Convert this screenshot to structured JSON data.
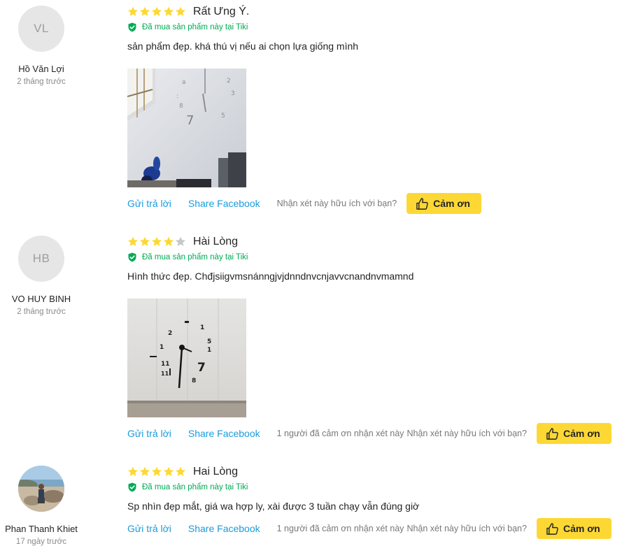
{
  "reviews": [
    {
      "avatar_initials": "VL",
      "user_name": "Hồ Văn Lợi",
      "date": "2 tháng trước",
      "rating": 5,
      "title": "Rất Ưng Ý.",
      "bought_label": "Đã mua sản phẩm này tại Tiki",
      "comment": "sản phẩm đẹp. khá thú vị nếu ai chọn lựa giống mình",
      "has_photo": true,
      "reply_label": "Gửi trả lời",
      "share_label": "Share Facebook",
      "thank_count_text": "",
      "helpful_question": "Nhận xét này hữu ích với bạn?",
      "thank_label": "Cảm ơn"
    },
    {
      "avatar_initials": "HB",
      "user_name": "VO HUY BINH",
      "date": "2 tháng trước",
      "rating": 4,
      "title": "Hài Lòng",
      "bought_label": "Đã mua sản phẩm này tại Tiki",
      "comment": "Hình thức đẹp. Chđjsiigvmsnánngjvjdnndnvcnjavvcnandnvmamnd",
      "has_photo": true,
      "reply_label": "Gửi trả lời",
      "share_label": "Share Facebook",
      "thank_count_text": "1 người đã cảm ơn nhận xét này",
      "helpful_question": "Nhận xét này hữu ích với bạn?",
      "thank_label": "Cảm ơn"
    },
    {
      "avatar_initials": "",
      "user_name": "Phan Thanh Khiet",
      "date": "17 ngày trước",
      "rating": 5,
      "title": "Hai Lòng",
      "bought_label": "Đã mua sản phẩm này tại Tiki",
      "comment": "Sp nhìn đẹp mắt, giá wa hợp ly, xài được 3 tuần chạy vẫn đúng giờ",
      "has_photo": false,
      "reply_label": "Gửi trả lời",
      "share_label": "Share Facebook",
      "thank_count_text": "1 người đã cảm ơn nhận xét này",
      "helpful_question": "Nhận xét này hữu ích với bạn?",
      "thank_label": "Cảm ơn"
    }
  ],
  "colors": {
    "star_filled": "#fdd835",
    "star_empty": "#c7c7c7",
    "verified_green": "#00ab56",
    "link_blue": "#1a9cdc",
    "thank_button": "#fdd835"
  }
}
